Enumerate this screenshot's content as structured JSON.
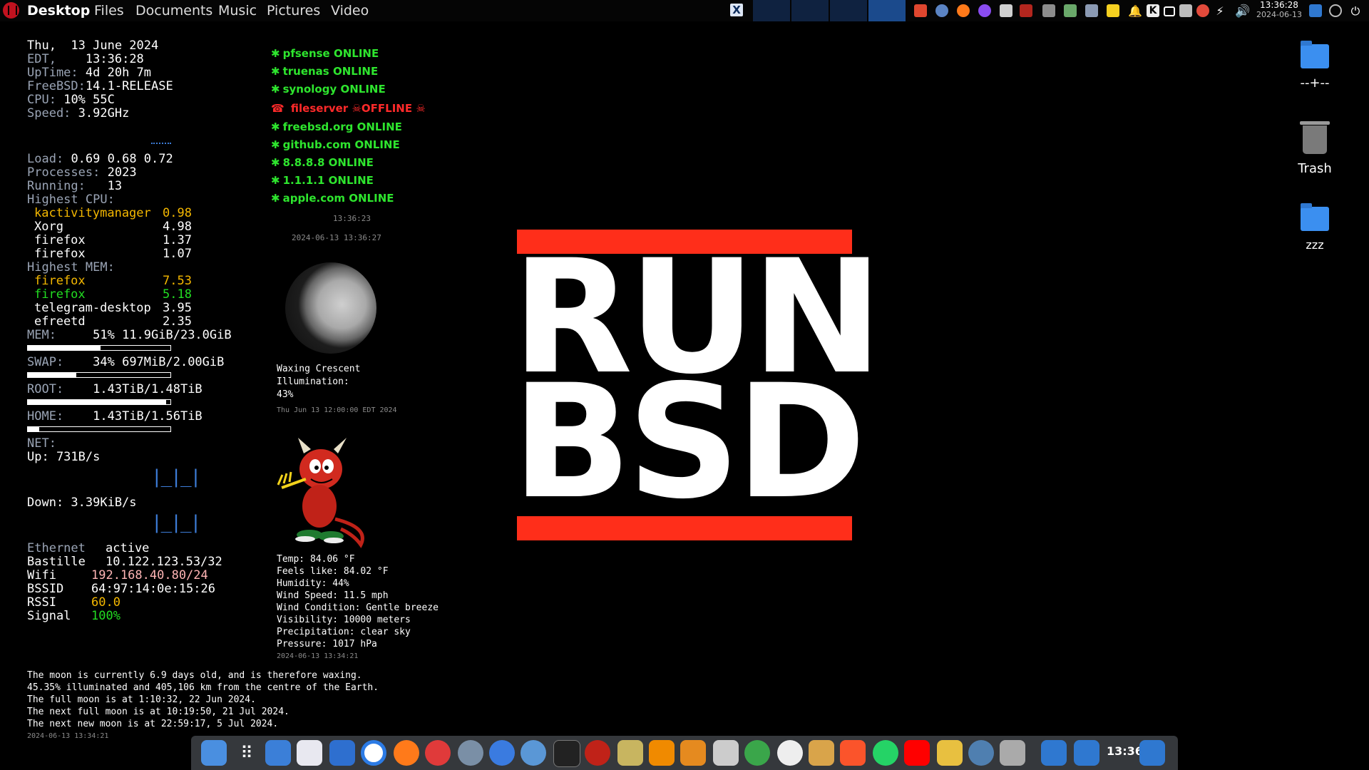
{
  "topbar": {
    "menus": [
      "Desktop",
      "Files",
      "Documents",
      "Music",
      "Pictures",
      "Video"
    ],
    "clock_time": "13:36:28",
    "clock_date": "2024-06-13"
  },
  "sysinfo": {
    "date_line": "Thu,  13 June 2024",
    "tz_label": "EDT,",
    "time": "13:36:28",
    "uptime_label": "UpTime:",
    "uptime": "4d 20h 7m",
    "os_label": "FreeBSD:",
    "os": "14.1-RELEASE",
    "cpu_label": "CPU:",
    "cpu": "10% 55C",
    "speed_label": "Speed:",
    "speed": "3.92GHz",
    "load_label": "Load:",
    "load": "0.69 0.68 0.72",
    "processes_label": "Processes:",
    "processes": "2023",
    "running_label": "Running:",
    "running": "13",
    "highest_cpu_label": "Highest CPU:",
    "highest_cpu": [
      {
        "name": "kactivitymanager",
        "value": "0.98"
      },
      {
        "name": "Xorg",
        "value": "4.98"
      },
      {
        "name": "firefox",
        "value": "1.37"
      },
      {
        "name": "firefox",
        "value": "1.07"
      }
    ],
    "highest_mem_label": "Highest MEM:",
    "highest_mem": [
      {
        "name": "firefox",
        "value": "7.53"
      },
      {
        "name": "firefox",
        "value": "5.18"
      },
      {
        "name": "telegram-desktop",
        "value": "3.95"
      },
      {
        "name": "efreetd",
        "value": "2.35"
      }
    ],
    "mem_label": "MEM:",
    "mem": "51% 11.9GiB/23.0GiB",
    "mem_fraction": 0.51,
    "swap_label": "SWAP:",
    "swap": "34% 697MiB/2.00GiB",
    "swap_fraction": 0.34,
    "root_label": "ROOT:",
    "root": "1.43TiB/1.48TiB",
    "root_fraction": 0.97,
    "home_label": "HOME:",
    "home": "1.43TiB/1.56TiB",
    "home_fraction": 0.08,
    "net_label": "NET:",
    "up": "Up: 731B/s",
    "down": "Down: 3.39KiB/s",
    "net_rows": [
      {
        "label": "Ethernet",
        "value": "active"
      },
      {
        "label": "Bastille",
        "value": "10.122.123.53/32"
      },
      {
        "label": "Wifi",
        "value": "192.168.40.80/24"
      },
      {
        "label": "BSSID",
        "value": "64:97:14:0e:15:26"
      },
      {
        "label": "RSSI",
        "value": "60.0"
      },
      {
        "label": "Signal",
        "value": "100%"
      }
    ]
  },
  "hosts": [
    {
      "name": "pfsense",
      "state": "ONLINE"
    },
    {
      "name": "truenas",
      "state": "ONLINE"
    },
    {
      "name": "synology",
      "state": "ONLINE"
    },
    {
      "name": "fileserver",
      "state": "OFFLINE"
    },
    {
      "name": "freebsd.org",
      "state": "ONLINE"
    },
    {
      "name": "github.com",
      "state": "ONLINE"
    },
    {
      "name": "8.8.8.8",
      "state": "ONLINE"
    },
    {
      "name": "1.1.1.1",
      "state": "ONLINE"
    },
    {
      "name": "apple.com",
      "state": "ONLINE"
    }
  ],
  "hosts_time": "13:36:23",
  "hosts_stamp": "2024-06-13 13:36:27",
  "moon": {
    "phase": "Waxing Crescent",
    "illum_label": "Illumination:",
    "illum": "43%",
    "stamp": "Thu Jun 13 12:00:00 EDT 2024"
  },
  "weather": {
    "temp": "Temp: 84.06 °F",
    "feels": "Feels like: 84.02 °F",
    "humidity": "Humidity: 44%",
    "wind_speed": "Wind Speed: 11.5 mph",
    "wind_cond": "Wind Condition: Gentle breeze",
    "visibility": "Visibility: 10000 meters",
    "precip": "Precipitation: clear sky",
    "pressure": "Pressure: 1017 hPa",
    "stamp": "2024-06-13 13:34:21"
  },
  "logo": {
    "line1": "RUN",
    "line2": "BSD"
  },
  "desktop_icons": [
    {
      "label": "--+--",
      "icon": "folder-icon"
    },
    {
      "label": "Trash",
      "icon": "trash-icon"
    },
    {
      "label": "zzz",
      "icon": "folder-icon"
    }
  ],
  "moon_text": {
    "l1": "The moon is currently 6.9 days old, and is therefore waxing.",
    "l2": "45.35% illuminated and 405,106 km from the centre of the Earth.",
    "l3": "The full moon is at 1:10:32, 22 Jun 2024.",
    "l4": "The next full moon is at 10:19:50, 21 Jul 2024.",
    "l5": "The next new moon is at 22:59:17, 5 Jul 2024.",
    "stamp": "2024-06-13 13:34:21"
  },
  "dock": {
    "clock": "13:36"
  },
  "colors": {
    "accent_red": "#ff2e1a",
    "online": "#2ee52e",
    "offline": "#ff2a2a",
    "highlight": "#f5b800"
  }
}
